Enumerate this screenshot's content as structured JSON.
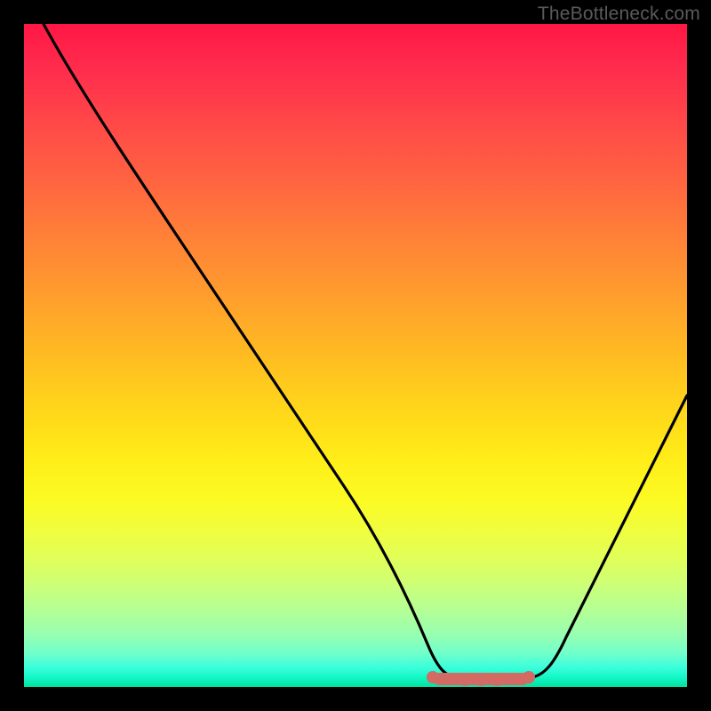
{
  "watermark": "TheBottleneck.com",
  "chart_data": {
    "type": "line",
    "title": "",
    "xlabel": "",
    "ylabel": "",
    "xlim": [
      0,
      100
    ],
    "ylim": [
      0,
      100
    ],
    "background": {
      "style": "vertical-gradient",
      "stops": [
        {
          "pos": 0,
          "color": "#ff1744"
        },
        {
          "pos": 50,
          "color": "#ffc400"
        },
        {
          "pos": 75,
          "color": "#ffee19"
        },
        {
          "pos": 100,
          "color": "#00e19e"
        }
      ]
    },
    "series": [
      {
        "name": "bottleneck-curve",
        "color": "#000000",
        "x": [
          3,
          10,
          20,
          30,
          40,
          50,
          58,
          62,
          66,
          70,
          74,
          78,
          80,
          85,
          90,
          95,
          100
        ],
        "y": [
          100,
          89,
          74,
          59,
          44,
          28,
          12,
          4.5,
          2,
          1.5,
          2,
          4.5,
          8,
          18,
          30,
          43,
          57
        ]
      },
      {
        "name": "optimal-band",
        "color": "#d36a63",
        "type": "marker-band",
        "x": [
          62,
          78
        ],
        "y": [
          1.5,
          1.5
        ]
      }
    ],
    "annotations": []
  }
}
